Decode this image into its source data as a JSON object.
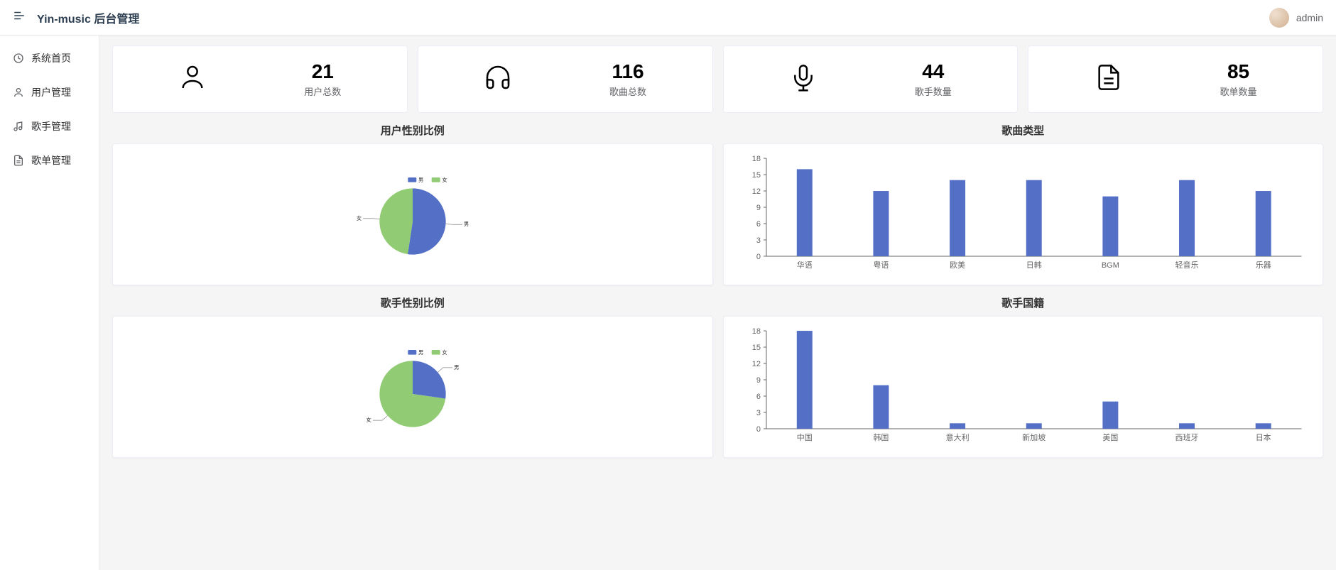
{
  "header": {
    "title": "Yin-music 后台管理",
    "username": "admin"
  },
  "sidebar": {
    "items": [
      {
        "label": "系统首页",
        "icon": "clock"
      },
      {
        "label": "用户管理",
        "icon": "user"
      },
      {
        "label": "歌手管理",
        "icon": "music-note"
      },
      {
        "label": "歌单管理",
        "icon": "document"
      }
    ]
  },
  "stats": [
    {
      "value": "21",
      "label": "用户总数",
      "icon": "user"
    },
    {
      "value": "116",
      "label": "歌曲总数",
      "icon": "headphones"
    },
    {
      "value": "44",
      "label": "歌手数量",
      "icon": "mic"
    },
    {
      "value": "85",
      "label": "歌单数量",
      "icon": "file"
    }
  ],
  "charts": {
    "pie_user": {
      "title": "用户性别比例",
      "legend": [
        "男",
        "女"
      ]
    },
    "pie_singer": {
      "title": "歌手性别比例",
      "legend": [
        "男",
        "女"
      ]
    },
    "bar_songtype": {
      "title": "歌曲类型"
    },
    "bar_country": {
      "title": "歌手国籍"
    }
  },
  "chart_data": [
    {
      "type": "pie",
      "title": "用户性别比例",
      "categories": [
        "男",
        "女"
      ],
      "values": [
        11,
        10
      ],
      "colors": [
        "#5470c6",
        "#91cc75"
      ]
    },
    {
      "type": "pie",
      "title": "歌手性别比例",
      "categories": [
        "男",
        "女"
      ],
      "values": [
        12,
        32
      ],
      "colors": [
        "#5470c6",
        "#91cc75"
      ]
    },
    {
      "type": "bar",
      "title": "歌曲类型",
      "categories": [
        "华语",
        "粤语",
        "欧美",
        "日韩",
        "BGM",
        "轻音乐",
        "乐器"
      ],
      "values": [
        16,
        12,
        14,
        14,
        11,
        14,
        12
      ],
      "ylabel": "",
      "xlabel": "",
      "ylim": [
        0,
        18
      ],
      "yticks": [
        0,
        3,
        6,
        9,
        12,
        15,
        18
      ]
    },
    {
      "type": "bar",
      "title": "歌手国籍",
      "categories": [
        "中国",
        "韩国",
        "意大利",
        "新加坡",
        "美国",
        "西班牙",
        "日本"
      ],
      "values": [
        18,
        8,
        1,
        1,
        5,
        1,
        1
      ],
      "ylabel": "",
      "xlabel": "",
      "ylim": [
        0,
        18
      ],
      "yticks": [
        0,
        3,
        6,
        9,
        12,
        15,
        18
      ]
    }
  ],
  "colors": {
    "bar": "#5470c6",
    "male": "#5470c6",
    "female": "#91cc75"
  }
}
